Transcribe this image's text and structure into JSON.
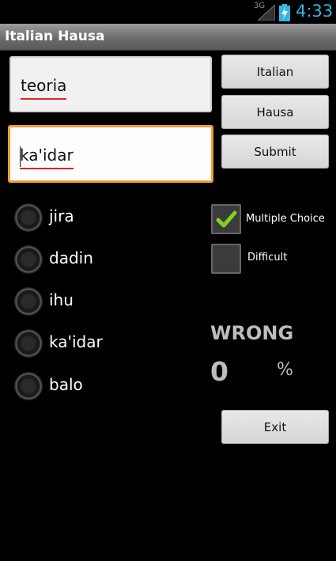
{
  "status_bar": {
    "network": "3G",
    "time": "4:33",
    "accent": "#33b5e5"
  },
  "app": {
    "title": "Italian Hausa"
  },
  "fields": {
    "source_word": "teoria",
    "answer_word": "ka'idar",
    "focus_color": "#f0a030"
  },
  "buttons": {
    "italian": "Italian",
    "hausa": "Hausa",
    "submit": "Submit",
    "exit": "Exit"
  },
  "choices": [
    {
      "label": "jira",
      "selected": false
    },
    {
      "label": "dadin",
      "selected": false
    },
    {
      "label": "ihu",
      "selected": false
    },
    {
      "label": "ka'idar",
      "selected": false
    },
    {
      "label": "balo",
      "selected": false
    }
  ],
  "options": {
    "multiple_choice": {
      "label": "Multiple Choice",
      "checked": true,
      "check_color": "#7ed321"
    },
    "difficult": {
      "label": "Difficult",
      "checked": false
    }
  },
  "result": {
    "status": "WRONG",
    "score": "0",
    "unit": "%"
  }
}
